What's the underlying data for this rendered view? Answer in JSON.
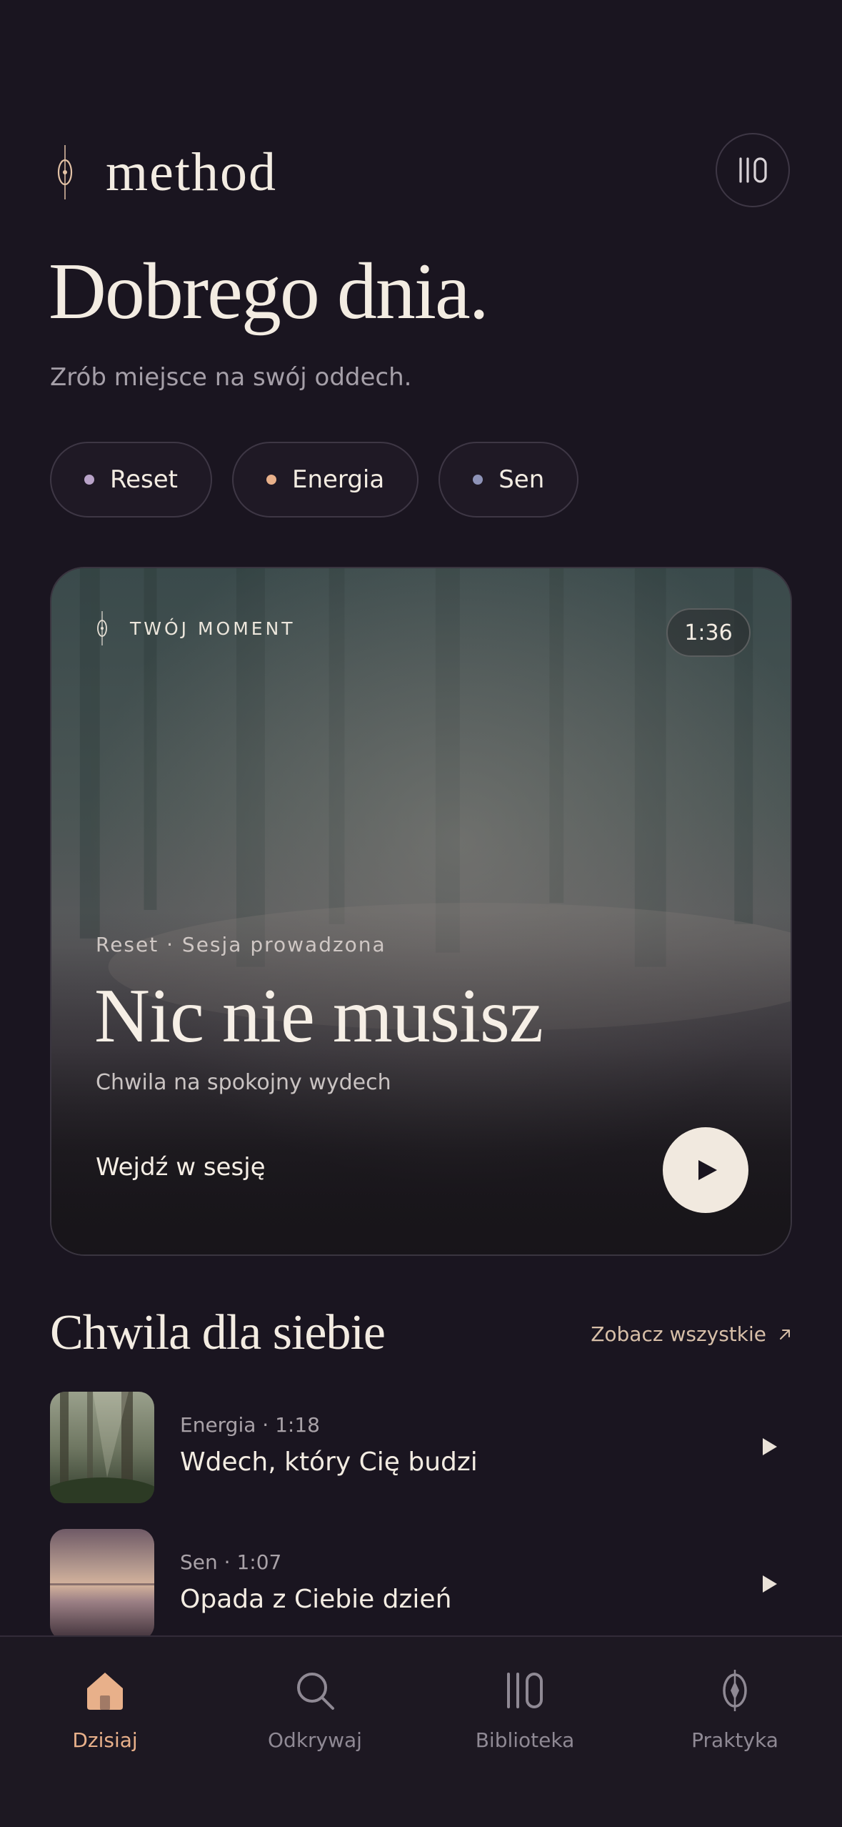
{
  "header": {
    "brand": "method",
    "brand_icon": "seed-icon",
    "library_button_icon": "library-icon"
  },
  "greeting": {
    "title": "Dobrego dnia.",
    "subtitle": "Zrób miejsce na swój oddech."
  },
  "moods": [
    {
      "label": "Reset",
      "dot_color": "#b9a3c9"
    },
    {
      "label": "Energia",
      "dot_color": "#e8b08a"
    },
    {
      "label": "Sen",
      "dot_color": "#8e93b8"
    }
  ],
  "hero": {
    "badge": "TWÓJ MOMENT",
    "duration": "1:36",
    "meta": "Reset · Sesja prowadzona",
    "title": "Nic nie musisz",
    "description": "Chwila na spokojny wydech",
    "cta": "Wejdź w sesję"
  },
  "section": {
    "title": "Chwila dla siebie",
    "see_all": "Zobacz wszystkie"
  },
  "sessions": [
    {
      "meta": "Energia · 1:18",
      "title": "Wdech, który Cię budzi",
      "thumb": "forest"
    },
    {
      "meta": "Sen · 1:07",
      "title": "Opada z Ciebie dzień",
      "thumb": "dusk-lake"
    }
  ],
  "nav": [
    {
      "label": "Dzisiaj",
      "icon": "home-icon",
      "active": true
    },
    {
      "label": "Odkrywaj",
      "icon": "search-icon",
      "active": false
    },
    {
      "label": "Biblioteka",
      "icon": "library-icon",
      "active": false
    },
    {
      "label": "Praktyka",
      "icon": "compass-icon",
      "active": false
    }
  ],
  "colors": {
    "background": "#1a1520",
    "accent": "#e8b08a",
    "text": "#f3ece2",
    "muted": "#a59fa8"
  }
}
